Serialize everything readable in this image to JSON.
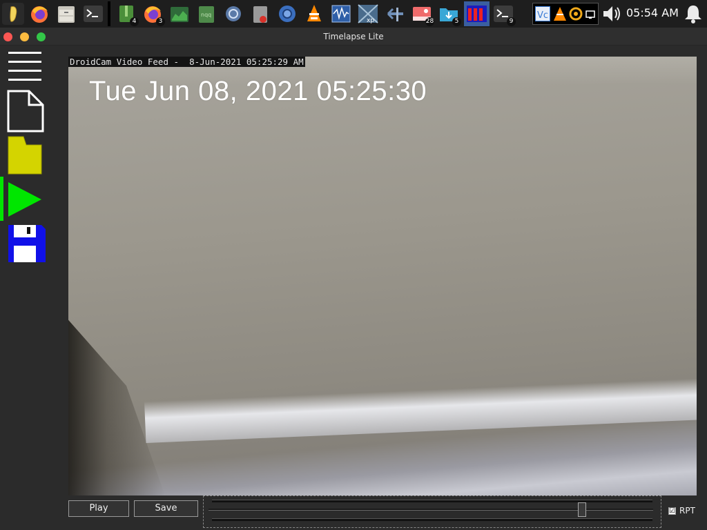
{
  "taskbar": {
    "badges": {
      "archive": "4",
      "firefox2": "3",
      "photos": "28",
      "downloads": "5",
      "terminal2": "9"
    },
    "clock": "05:54 AM"
  },
  "window": {
    "title": "Timelapse Lite"
  },
  "video": {
    "caption": "DroidCam Video Feed -  8-Jun-2021 05:25:29 AM",
    "timestamp": "Tue Jun 08, 2021 05:25:30"
  },
  "controls": {
    "play_label": "Play",
    "save_label": "Save",
    "slider_fraction": 0.84,
    "rpt_label": "RPT",
    "rpt_checked": true,
    "rpt_mark": "☑"
  },
  "colors": {
    "close": "#fc5753",
    "minimize": "#fdbc40",
    "maximize": "#33c748",
    "folder": "#d4d400",
    "play": "#00e600",
    "floppy": "#1010e8"
  }
}
